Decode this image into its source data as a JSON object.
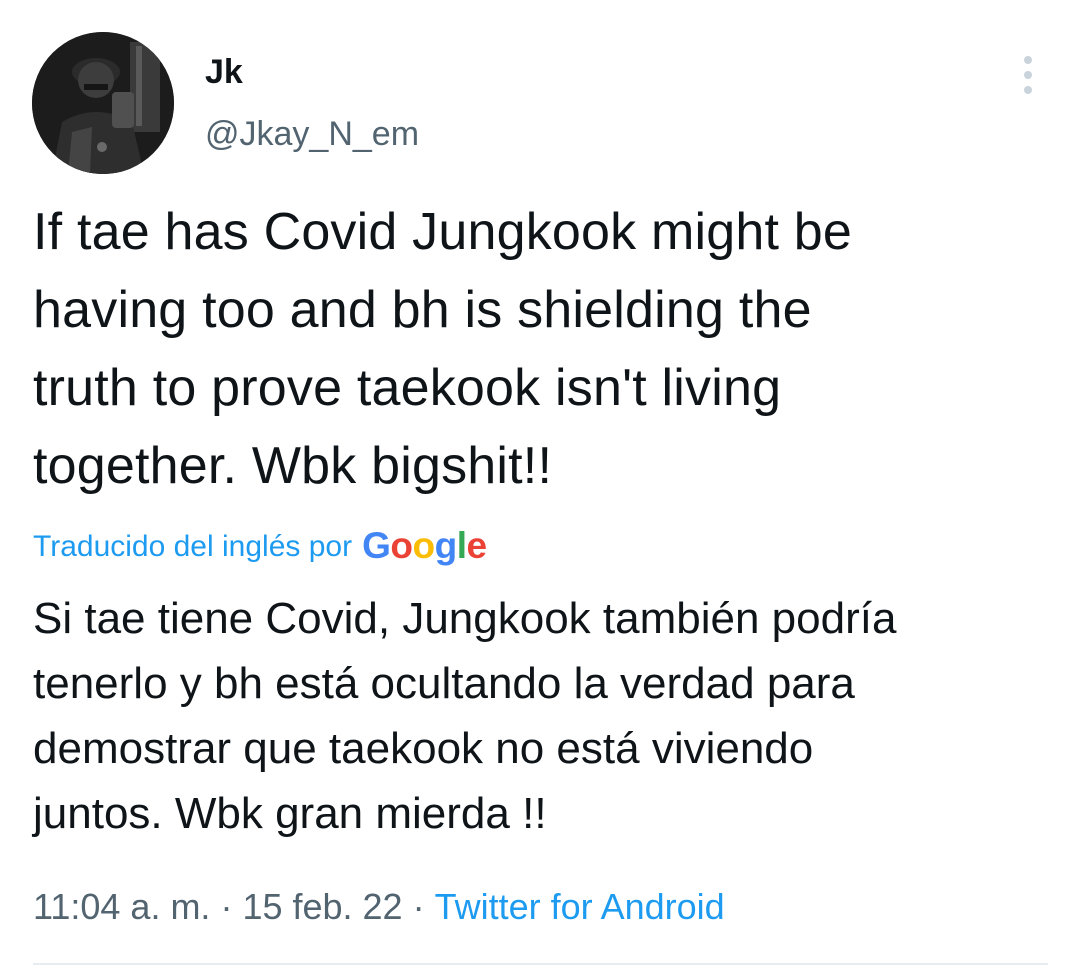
{
  "tweet": {
    "author": {
      "display_name": "Jk",
      "handle": "@Jkay_N_em",
      "avatar_icon": "user-avatar-photo"
    },
    "text": "If tae has Covid Jungkook might be\nhaving too and bh is shielding the\ntruth to prove taekook isn't living\ntogether. Wbk bigshit!!",
    "translation": {
      "label": "Traducido del inglés por",
      "provider": "Google",
      "text": "Si tae tiene Covid, Jungkook también podría\ntenerlo y bh está ocultando la verdad para\ndemostrar que taekook no está viviendo\njuntos. Wbk gran mierda !!"
    },
    "meta": {
      "time": "11:04 a. m.",
      "separator": "·",
      "date": "15 feb. 22",
      "source": "Twitter for Android"
    }
  },
  "icons": {
    "more": "more-vertical-icon"
  },
  "colors": {
    "accent": "#1d9bf0",
    "secondary_text": "#536471",
    "primary_text": "#0f1419",
    "google_blue": "#4285F4",
    "google_red": "#EA4335",
    "google_yellow": "#FBBC05",
    "google_green": "#34A853"
  }
}
